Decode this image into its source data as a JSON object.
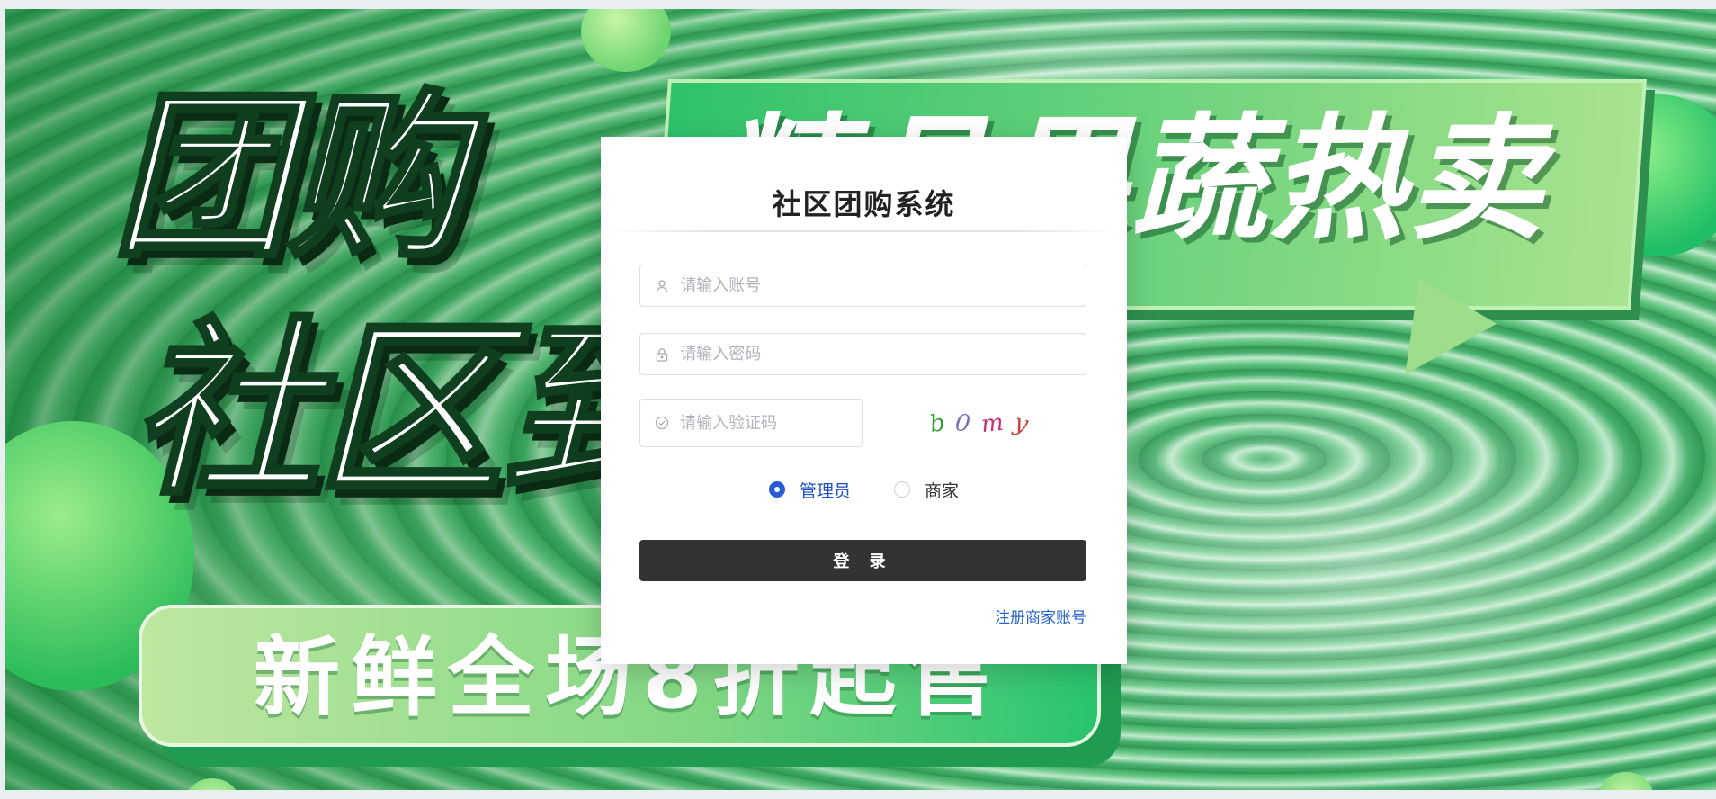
{
  "banner": {
    "headline_line1": "团购",
    "headline_line2": "社区到付",
    "bubble_text": "精品果蔬热卖",
    "pill_text": "新鲜全场8折起售"
  },
  "login": {
    "title": "社区团购系统",
    "username": {
      "placeholder": "请输入账号",
      "value": "",
      "icon": "user-icon"
    },
    "password": {
      "placeholder": "请输入密码",
      "value": "",
      "icon": "lock-icon"
    },
    "captcha": {
      "placeholder": "请输入验证码",
      "value": "",
      "icon": "check-circle-icon"
    },
    "captcha_image": {
      "chars": [
        "b",
        "0",
        "m",
        "y"
      ]
    },
    "roles": [
      {
        "label": "管理员",
        "checked": true
      },
      {
        "label": "商家",
        "checked": false
      }
    ],
    "submit_label": "登 录",
    "register_link": "注册商家账号"
  },
  "colors": {
    "primary_button": "#333333",
    "radio_checked": "#2a5bd7",
    "link": "#2a63c9",
    "banner_green": "#2fc26a"
  }
}
